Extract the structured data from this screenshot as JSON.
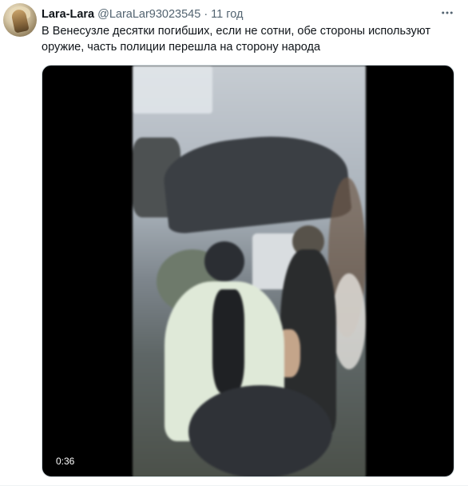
{
  "tweet": {
    "author_name": "Lara-Lara",
    "author_handle": "@LaraLar93023545",
    "separator": "·",
    "time": "11 год",
    "text": "В Венесузле десятки погибших, если не сотни, обе стороны используют оружие, часть полиции перешла на сторону народа",
    "more_icon": "more-horizontal-icon"
  },
  "video": {
    "duration": "0:36"
  }
}
